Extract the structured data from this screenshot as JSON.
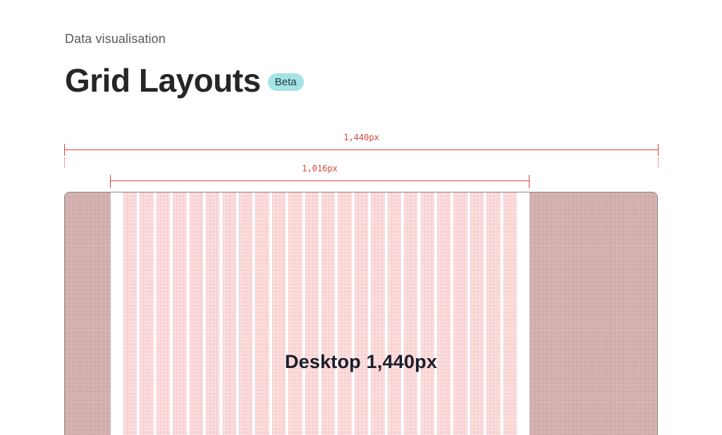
{
  "header": {
    "breadcrumb": "Data visualisation",
    "title": "Grid Layouts",
    "badge": "Beta"
  },
  "colors": {
    "accent_red": "#d6473c",
    "margin_fill": "#d6b3b3",
    "column_fill": "#fddede",
    "badge_bg": "#a6e3e6"
  },
  "diagram": {
    "outer_width_label": "1,440px",
    "inner_width_label": "1,016px",
    "frame_label": "Desktop 1,440px",
    "column_count": 24
  }
}
